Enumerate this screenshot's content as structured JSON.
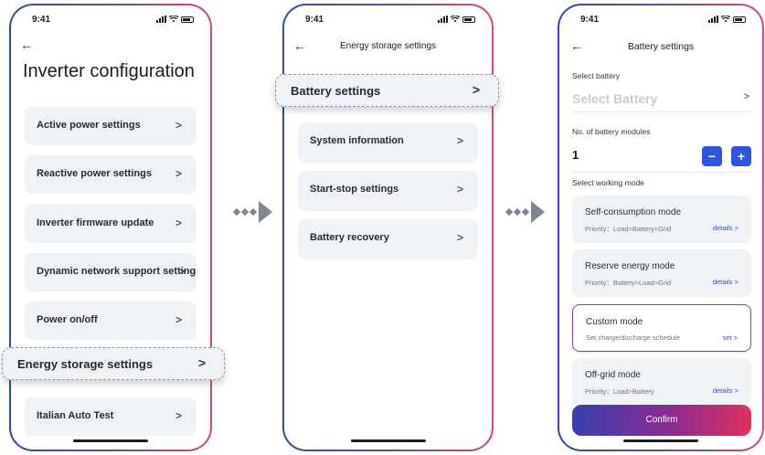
{
  "status": {
    "time": "9:41"
  },
  "screen1": {
    "title": "Inverter configuration",
    "items": [
      "Active power settings",
      "Reactive power settings",
      "Inverter firmware update",
      "Dynamic network support setting",
      "Power on/off",
      "Italian Auto Test"
    ],
    "highlight": "Energy storage settings"
  },
  "screen2": {
    "title": "Energy storage settings",
    "highlight": "Battery settings",
    "items": [
      "System information",
      "Start-stop settings",
      "Battery recovery"
    ]
  },
  "screen3": {
    "title": "Battery settings",
    "select_battery_label": "Select battery",
    "select_battery_placeholder": "Select Battery",
    "modules_label": "No. of battery modules",
    "modules_value": "1",
    "minus": "−",
    "plus": "+",
    "working_mode_label": "Select working mode",
    "modes": [
      {
        "title": "Self-consumption mode",
        "sub": "Priority：Load>Battery>Grid",
        "action": "details >"
      },
      {
        "title": "Reserve energy mode",
        "sub": "Priority：Battery>Load>Grid",
        "action": "details >"
      },
      {
        "title": "Custom mode",
        "sub": "Set charge/discharge schedule",
        "action": "set >"
      },
      {
        "title": "Off-grid mode",
        "sub": "Priority：Load>Battery",
        "action": "details >"
      }
    ],
    "confirm": "Confirm"
  },
  "icons": {
    "back": "←",
    "chevron": ">",
    "flow_arrow": "arrow-right-icon"
  },
  "colors": {
    "primary": "#2f55e0",
    "card_bg": "#f0f3f6",
    "selected_border": "#8a3f9a"
  }
}
